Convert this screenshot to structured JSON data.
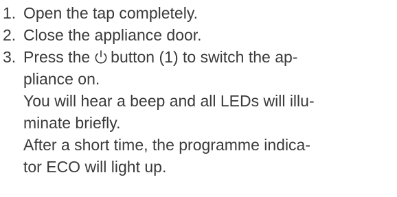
{
  "steps": [
    {
      "number": "1.",
      "lines": [
        "Open the tap completely."
      ]
    },
    {
      "number": "2.",
      "lines": [
        "Close the appliance door."
      ]
    },
    {
      "number": "3.",
      "lead_before_icon": "Press the",
      "icon": "power-icon",
      "lead_after_icon": "button (1) to switch the ap-",
      "lines": [
        "pliance on.",
        "You will hear a beep and all LEDs will illu-",
        "minate briefly.",
        "After a short time, the programme indica-",
        "tor ECO will light up."
      ]
    }
  ],
  "colors": {
    "text": "#3a3a3a"
  }
}
